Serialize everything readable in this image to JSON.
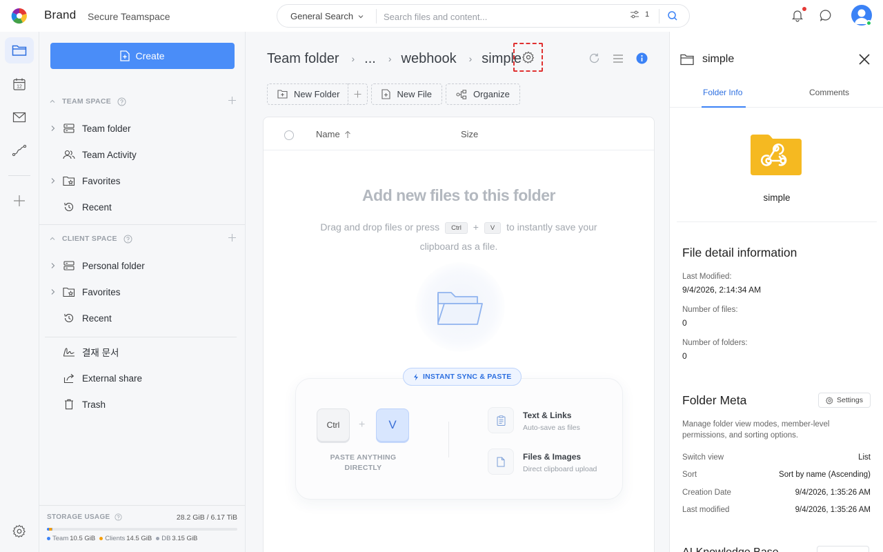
{
  "header": {
    "brand": "Brand",
    "teamspace": "Secure Teamspace",
    "search_scope": "General Search",
    "search_placeholder": "Search files and content...",
    "filter_count": "1",
    "icons": [
      "logo-icon",
      "chevron-down-icon",
      "filter-icon",
      "search-icon",
      "bell-icon",
      "chat-icon",
      "avatar"
    ]
  },
  "rail": {
    "items": [
      "folder-icon",
      "calendar-icon",
      "mail-icon",
      "workflow-icon",
      "plus-icon",
      "settings-icon"
    ],
    "calendar_day": "12"
  },
  "sidebar": {
    "create_label": "Create",
    "team_space": {
      "title": "TEAM SPACE",
      "items": [
        {
          "label": "Team folder",
          "icon": "server-icon"
        },
        {
          "label": "Team Activity",
          "icon": "users-icon"
        },
        {
          "label": "Favorites",
          "icon": "star-folder-icon"
        },
        {
          "label": "Recent",
          "icon": "history-icon"
        }
      ]
    },
    "client_space": {
      "title": "CLIENT SPACE",
      "items": [
        {
          "label": "Personal folder",
          "icon": "server-icon"
        },
        {
          "label": "Favorites",
          "icon": "star-folder-icon"
        },
        {
          "label": "Recent",
          "icon": "history-icon"
        }
      ]
    },
    "extra": [
      {
        "label": "결재 문서",
        "icon": "signature-icon"
      },
      {
        "label": "External share",
        "icon": "share-icon"
      },
      {
        "label": "Trash",
        "icon": "trash-icon"
      }
    ],
    "storage": {
      "title": "STORAGE USAGE",
      "total": "28.2 GiB / 6.17 TiB",
      "team_label": "Team",
      "team_value": "10.5 GiB",
      "team_color": "#3b82f6",
      "clients_label": "Clients",
      "clients_value": "14.5 GiB",
      "clients_color": "#f59e0b",
      "db_label": "DB",
      "db_value": "3.15 GiB",
      "db_color": "#9ca3af"
    }
  },
  "main": {
    "breadcrumbs": [
      "Team folder",
      "...",
      "webhook",
      "simple"
    ],
    "toolbar": {
      "new_folder": "New Folder",
      "new_file": "New File",
      "organize": "Organize"
    },
    "table": {
      "col_name": "Name",
      "col_size": "Size"
    },
    "empty": {
      "title": "Add new files to this folder",
      "desc_before": "Drag and drop files or press",
      "key_ctrl": "Ctrl",
      "plus": "+",
      "key_v": "V",
      "desc_after": "to instantly save your clipboard as a file."
    },
    "sync": {
      "pill": "INSTANT SYNC & PASTE",
      "key_ctrl": "Ctrl",
      "key_plus": "+",
      "key_v": "V",
      "paste_label": "PASTE ANYTHING DIRECTLY",
      "feature1_title": "Text & Links",
      "feature1_sub": "Auto-save as files",
      "feature2_title": "Files & Images",
      "feature2_sub": "Direct clipboard upload"
    }
  },
  "details": {
    "title": "simple",
    "tabs": [
      "Folder Info",
      "Comments"
    ],
    "active_tab": "Folder Info",
    "folder_name": "simple",
    "file_detail_title": "File detail information",
    "last_modified_label": "Last Modified:",
    "last_modified_value": "9/4/2026, 2:14:34 AM",
    "num_files_label": "Number of files:",
    "num_files_value": "0",
    "num_folders_label": "Number of folders:",
    "num_folders_value": "0",
    "meta_title": "Folder Meta",
    "meta_settings": "Settings",
    "meta_desc": "Manage folder view modes, member-level permissions, and sorting options.",
    "rows": [
      {
        "k": "Switch view",
        "v": "List"
      },
      {
        "k": "Sort",
        "v": "Sort by name (Ascending)"
      },
      {
        "k": "Creation Date",
        "v": "9/4/2026, 1:35:26 AM"
      },
      {
        "k": "Last modified",
        "v": "9/4/2026, 1:35:26 AM"
      }
    ],
    "next_section": "AI Knowledge Base"
  },
  "colors": {
    "accent": "#4a8df8",
    "focus_outline": "#e03131",
    "folder_yellow": "#f5b921"
  }
}
